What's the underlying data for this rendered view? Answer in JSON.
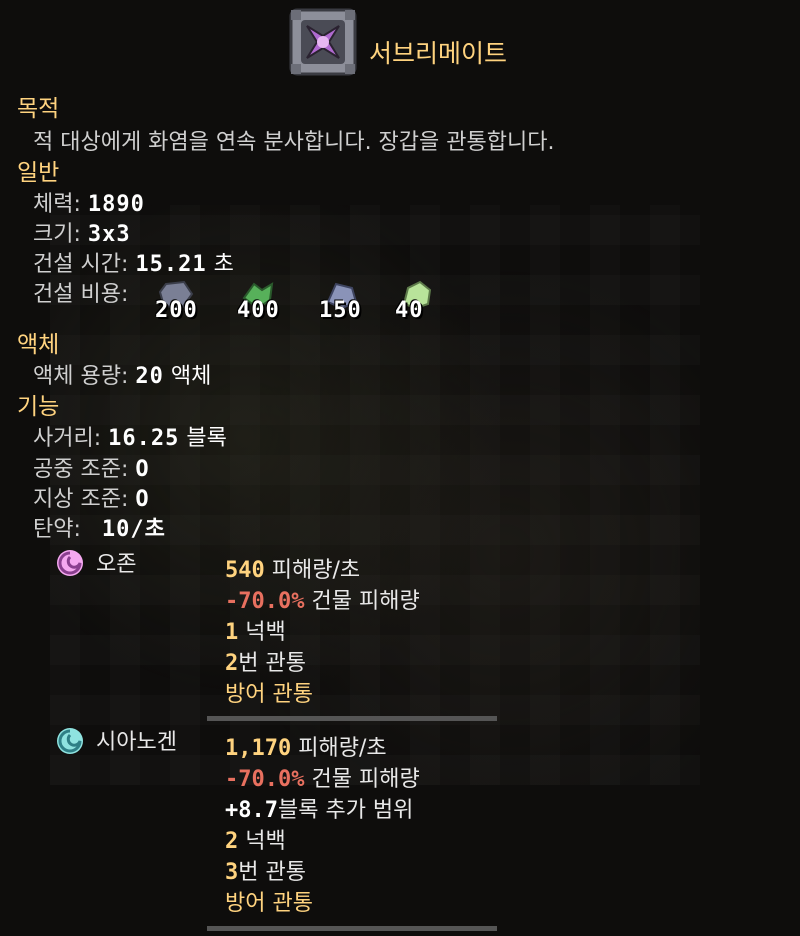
{
  "title": "서브리메이트",
  "purpose": {
    "heading": "목적",
    "description": "적 대상에게 화염을 연속 분사합니다. 장갑을 관통합니다."
  },
  "general": {
    "heading": "일반",
    "health_label": "체력:",
    "health_value": "1890",
    "size_label": "크기:",
    "size_value": "3x3",
    "build_time_label": "건설 시간:",
    "build_time_value": "15.21",
    "build_time_unit": "초",
    "build_cost_label": "건설 비용:",
    "costs": [
      {
        "icon": "tungsten-icon",
        "amount": "200",
        "color": "#7a7f95"
      },
      {
        "icon": "beryllium-icon",
        "amount": "400",
        "color": "#57b05a"
      },
      {
        "icon": "silicon-icon",
        "amount": "150",
        "color": "#8a93b8"
      },
      {
        "icon": "oxide-icon",
        "amount": "40",
        "color": "#b8e39a"
      }
    ]
  },
  "liquid": {
    "heading": "액체",
    "capacity_label": "액체 용량:",
    "capacity_value": "20",
    "capacity_unit": "액체"
  },
  "function": {
    "heading": "기능",
    "range_label": "사거리:",
    "range_value": "16.25",
    "range_unit": "블록",
    "air_label": "공중 조준:",
    "air_value": "O",
    "ground_label": "지상 조준:",
    "ground_value": "O",
    "ammo_label": "탄약:",
    "ammo_value": "10/초"
  },
  "ammo": [
    {
      "name": "오존",
      "icon_color": "#f5a8f0",
      "dps_value": "540",
      "dps_unit": "피해량/초",
      "building_value": "-70.0%",
      "building_text": "건물 피해량",
      "knockback_value": "1",
      "knockback_text": "넉백",
      "pierce_value": "2",
      "pierce_text": "번 관통",
      "armor_text": "방어 관통"
    },
    {
      "name": "시아노겐",
      "icon_color": "#8fe3e0",
      "dps_value": "1,170",
      "dps_unit": "피해량/초",
      "building_value": "-70.0%",
      "building_text": "건물 피해량",
      "range_value": "+8.7",
      "range_text": "블록 추가 범위",
      "knockback_value": "2",
      "knockback_text": "넉백",
      "pierce_value": "3",
      "pierce_text": "번 관통",
      "armor_text": "방어 관통"
    }
  ]
}
